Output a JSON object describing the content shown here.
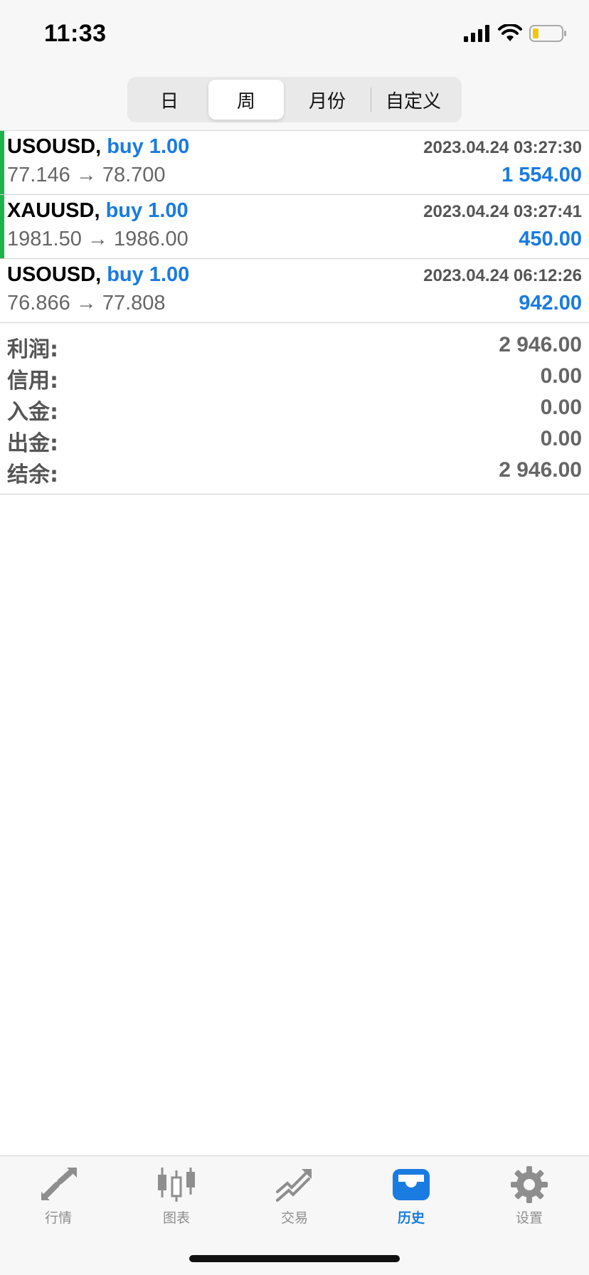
{
  "status": {
    "time": "11:33"
  },
  "period_tabs": [
    "日",
    "周",
    "月份",
    "自定义"
  ],
  "active_period": "周",
  "trades": [
    {
      "symbol": "USOUSD,",
      "type": " buy 1.00",
      "time": "2023.04.24 03:27:30",
      "prices": "77.146 → 78.700",
      "profit": "1 554.00",
      "marker": true
    },
    {
      "symbol": "XAUUSD,",
      "type": " buy 1.00",
      "time": "2023.04.24 03:27:41",
      "prices": "1981.50 → 1986.00",
      "profit": "450.00",
      "marker": true
    },
    {
      "symbol": "USOUSD,",
      "type": " buy 1.00",
      "time": "2023.04.24 06:12:26",
      "prices": "76.866 → 77.808",
      "profit": "942.00",
      "marker": false
    }
  ],
  "summary": [
    {
      "label": "利润:",
      "value": "2 946.00"
    },
    {
      "label": "信用:",
      "value": "0.00"
    },
    {
      "label": "入金:",
      "value": "0.00"
    },
    {
      "label": "出金:",
      "value": "0.00"
    },
    {
      "label": "结余:",
      "value": "2 946.00"
    }
  ],
  "tabbar": [
    {
      "label": "行情",
      "icon": "quotes-icon"
    },
    {
      "label": "图表",
      "icon": "chart-icon"
    },
    {
      "label": "交易",
      "icon": "trade-icon"
    },
    {
      "label": "历史",
      "icon": "history-icon",
      "active": true
    },
    {
      "label": "设置",
      "icon": "settings-icon"
    }
  ],
  "colors": {
    "accent": "#1a7be0",
    "marker": "#1fb24a",
    "inactive": "#8e8e8e"
  }
}
